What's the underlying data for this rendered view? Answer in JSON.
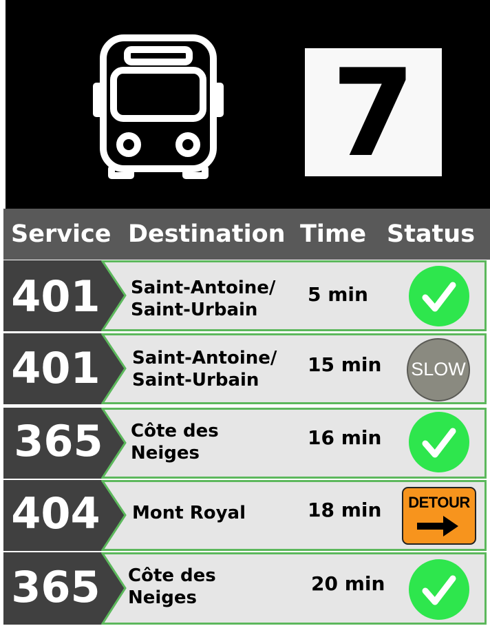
{
  "header": {
    "stop_number": "7",
    "bus_icon": "bus-front-icon"
  },
  "columns": {
    "service": "Service",
    "destination": "Destination",
    "time": "Time",
    "status": "Status"
  },
  "rows": [
    {
      "route": "401",
      "destination_line1": "Saint-Antoine/",
      "destination_line2": "Saint-Urbain",
      "time": "5 min",
      "status": "on-time",
      "status_icon": "check-icon"
    },
    {
      "route": "401",
      "destination_line1": "Saint-Antoine/",
      "destination_line2": "Saint-Urbain",
      "time": "15 min",
      "status": "slow",
      "status_label": "SLOW",
      "status_icon": "slow-sign-icon"
    },
    {
      "route": "365",
      "destination_line1": "Côte des",
      "destination_line2": "Neiges",
      "time": "16 min",
      "status": "on-time",
      "status_icon": "check-icon"
    },
    {
      "route": "404",
      "destination_line1": "Mont Royal",
      "destination_line2": "",
      "time": "18 min",
      "status": "detour",
      "status_label": "DETOUR",
      "status_icon": "detour-sign-icon"
    },
    {
      "route": "365",
      "destination_line1": "Côte des",
      "destination_line2": "Neiges",
      "time": "20 min",
      "status": "on-time",
      "status_icon": "check-icon"
    }
  ],
  "colors": {
    "header_bg": "#000000",
    "column_bar": "#595959",
    "row_bg": "#e6e6e6",
    "row_border": "#5cb85c",
    "route_badge": "#404040",
    "on_time": "#2ee64d",
    "slow": "#8a8a80",
    "detour": "#f7941d"
  }
}
